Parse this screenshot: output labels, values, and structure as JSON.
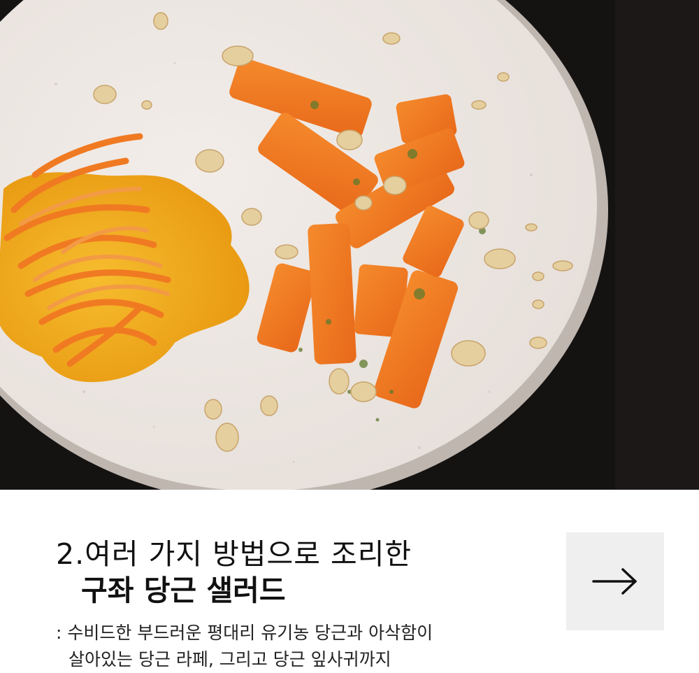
{
  "photo": {
    "alt": "구좌 당근 샐러드"
  },
  "caption": {
    "title_line1": "2.여러 가지 방법으로 조리한",
    "title_line2": "구좌 당근 샐러드",
    "description_line1": ": 수비드한 부드러운 평대리 유기농 당근과 아삭함이",
    "description_line2": "살아있는 당근 라페, 그리고 당근 잎사귀까지"
  },
  "next_button": {
    "icon": "arrow-right-icon"
  },
  "colors": {
    "background_dark": "#151312",
    "plate": "#ece6e2",
    "carrot": "#f07a22",
    "sauce": "#f2ae1e",
    "button_bg": "#efefef",
    "text": "#111111"
  }
}
